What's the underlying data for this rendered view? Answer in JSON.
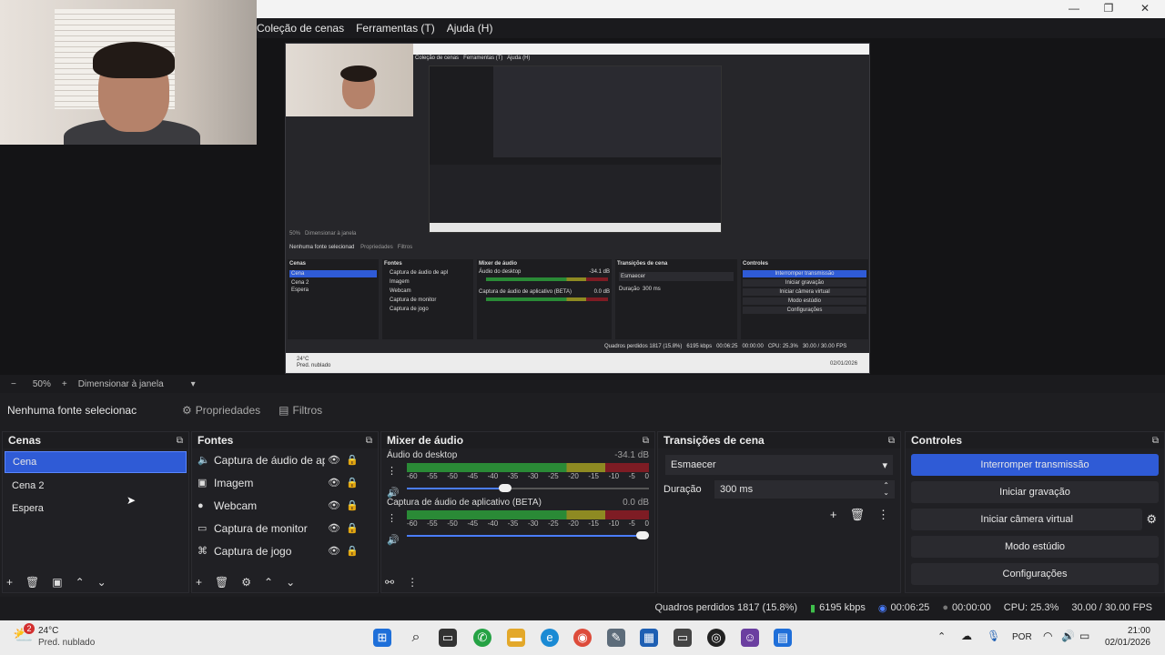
{
  "menu": [
    "Coleção de cenas",
    "Ferramentas (T)",
    "Ajuda (H)"
  ],
  "window_controls": {
    "minimize": "—",
    "maximize": "❐",
    "close": "✕"
  },
  "zoombar": {
    "minus": "−",
    "zoom": "50%",
    "plus": "+",
    "mode": "Dimensionar à janela",
    "arrow": "▾"
  },
  "propbar": {
    "no_source": "Nenhuma fonte selecionac",
    "properties": "Propriedades",
    "filters": "Filtros"
  },
  "nested_preview": {
    "menu": [
      "Coleção de cenas",
      "Ferramentas (T)",
      "Ajuda (H)"
    ],
    "no_source": "Nenhuma fonte selecionad",
    "properties": "Propriedades",
    "filters": "Filtros",
    "zoom": "50%",
    "mode": "Dimensionar à janela",
    "scenes_title": "Cenas",
    "scenes": [
      "Cena",
      "Cena 2",
      "Espera"
    ],
    "sources_title": "Fontes",
    "sources": [
      "Captura de áudio de apl",
      "Imagem",
      "Webcam",
      "Captura de monitor",
      "Captura de jogo"
    ],
    "mixer_title": "Mixer de áudio",
    "mixer_1": "Áudio do desktop",
    "mixer_1_db": "-34.1 dB",
    "mixer_2": "Captura de áudio de aplicativo (BETA)",
    "mixer_2_db": "0.0 dB",
    "trans_title": "Transições de cena",
    "trans_value": "Esmaecer",
    "duration_label": "Duração",
    "duration_value": "300 ms",
    "controls_title": "Controles",
    "controls": [
      "Interromper transmissão",
      "Iniciar gravação",
      "Iniciar câmera virtual",
      "Modo estúdio",
      "Configurações"
    ],
    "status": [
      "Quadros perdidos 1817 (15.8%)",
      "6195 kbps",
      "00:06:25",
      "00:00:00",
      "CPU: 25.3%",
      "30.00 / 30.00 FPS"
    ],
    "weather_temp": "24°C",
    "weather_desc": "Pred. nublado",
    "date": "02/01/2026"
  },
  "scenes": {
    "title": "Cenas",
    "items": [
      "Cena",
      "Cena 2",
      "Espera"
    ],
    "selected": 0
  },
  "sources": {
    "title": "Fontes",
    "items": [
      {
        "icon": "🔈",
        "name": "Captura de áudio de apl"
      },
      {
        "icon": "▣",
        "name": "Imagem"
      },
      {
        "icon": "●",
        "name": "Webcam"
      },
      {
        "icon": "▭",
        "name": "Captura de monitor"
      },
      {
        "icon": "⌘",
        "name": "Captura de jogo"
      }
    ]
  },
  "mixer": {
    "title": "Mixer de áudio",
    "ticks": [
      "-60",
      "-55",
      "-50",
      "-45",
      "-40",
      "-35",
      "-30",
      "-25",
      "-20",
      "-15",
      "-10",
      "-5",
      "0"
    ],
    "channels": [
      {
        "name": "Áudio do desktop",
        "db": "-34.1 dB",
        "volume": 0.4
      },
      {
        "name": "Captura de áudio de aplicativo (BETA)",
        "db": "0.0 dB",
        "volume": 1.0
      }
    ]
  },
  "transitions": {
    "title": "Transições de cena",
    "type": "Esmaecer",
    "duration_label": "Duração",
    "duration": "300 ms"
  },
  "controls": {
    "title": "Controles",
    "stream": "Interromper transmissão",
    "record": "Iniciar gravação",
    "virtual_cam": "Iniciar câmera virtual",
    "studio": "Modo estúdio",
    "settings": "Configurações"
  },
  "status": {
    "dropped": "Quadros perdidos 1817 (15.8%)",
    "bitrate": "6195 kbps",
    "stream_time": "00:06:25",
    "rec_time": "00:00:00",
    "cpu": "CPU: 25.3%",
    "fps": "30.00 / 30.00 FPS"
  },
  "taskbar": {
    "weather_temp": "24°C",
    "weather_desc": "Pred. nublado",
    "weather_badge": "2",
    "lang": "POR",
    "time": "21:00",
    "date": "02/01/2026"
  }
}
